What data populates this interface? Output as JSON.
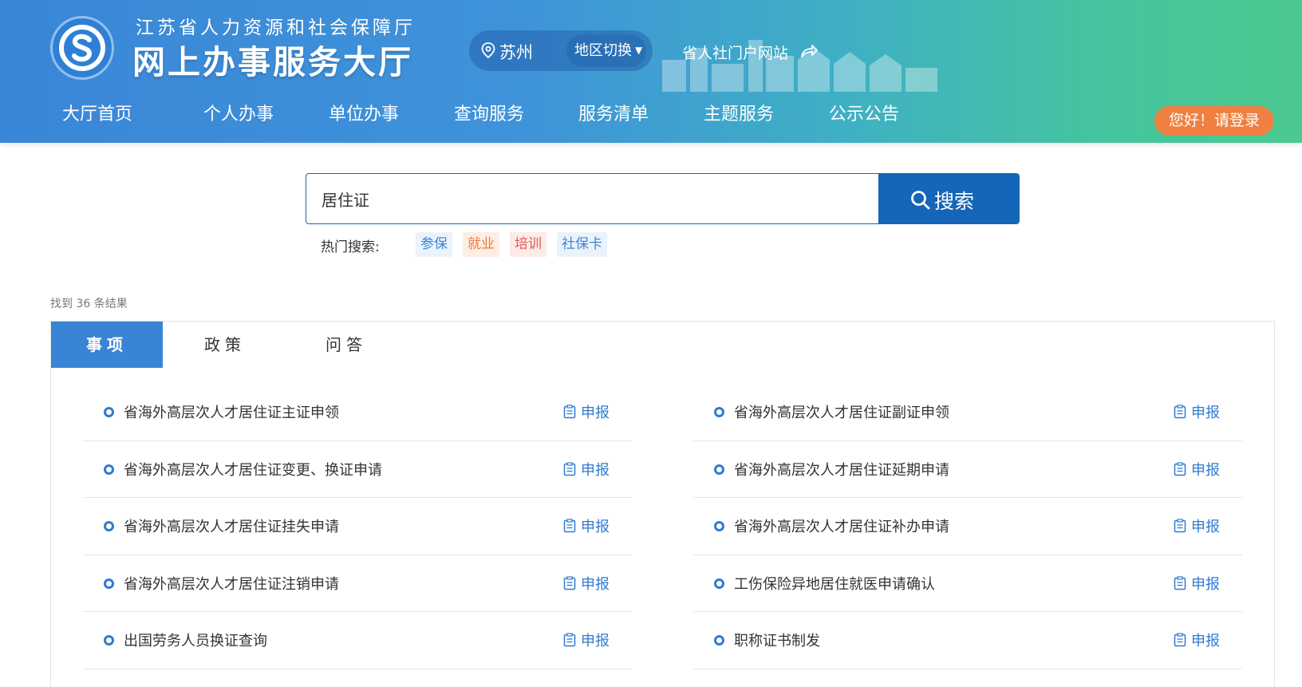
{
  "header": {
    "title_top": "江苏省人力资源和社会保障厅",
    "title_main": "网上办事服务大厅",
    "city": "苏州",
    "region_switch": "地区切换",
    "portal_link": "省人社门户网站",
    "login": "您好！请登录",
    "icons": {
      "logo": "jiangsu-hrss-logo",
      "location": "map-pin-icon",
      "dropdown": "caret-down-icon",
      "portal": "share-arrow-icon"
    }
  },
  "nav": {
    "items": [
      {
        "label": "大厅首页"
      },
      {
        "label": "个人办事"
      },
      {
        "label": "单位办事"
      },
      {
        "label": "查询服务"
      },
      {
        "label": "服务清单"
      },
      {
        "label": "主题服务"
      },
      {
        "label": "公示公告"
      }
    ]
  },
  "search": {
    "value": "居住证",
    "button": "搜索",
    "hot_label": "热门搜索:",
    "hot_tags": [
      {
        "label": "参保",
        "color": "#3d86d6",
        "bg": "#eaf3fc"
      },
      {
        "label": "就业",
        "color": "#ee7a3c",
        "bg": "#fdeee5"
      },
      {
        "label": "培训",
        "color": "#e05a4e",
        "bg": "#fcebe9"
      },
      {
        "label": "社保卡",
        "color": "#3d86d6",
        "bg": "#eaf3fc"
      }
    ]
  },
  "results": {
    "found_text": "找到 36 条结果",
    "tabs": [
      {
        "label": "事项",
        "active": true
      },
      {
        "label": "政策",
        "active": false
      },
      {
        "label": "问答",
        "active": false
      }
    ],
    "apply_label": "申报",
    "left": [
      {
        "title": "省海外高层次人才居住证主证申领"
      },
      {
        "title": "省海外高层次人才居住证变更、换证申请"
      },
      {
        "title": "省海外高层次人才居住证挂失申请"
      },
      {
        "title": "省海外高层次人才居住证注销申请"
      },
      {
        "title": "出国劳务人员换证查询"
      }
    ],
    "right": [
      {
        "title": "省海外高层次人才居住证副证申领"
      },
      {
        "title": "省海外高层次人才居住证延期申请"
      },
      {
        "title": "省海外高层次人才居住证补办申请"
      },
      {
        "title": "工伤保险异地居住就医申请确认"
      },
      {
        "title": "职称证书制发"
      }
    ]
  },
  "colors": {
    "primary": "#1565b8",
    "accent_orange": "#f08041",
    "tab_active": "#3a84d5"
  }
}
